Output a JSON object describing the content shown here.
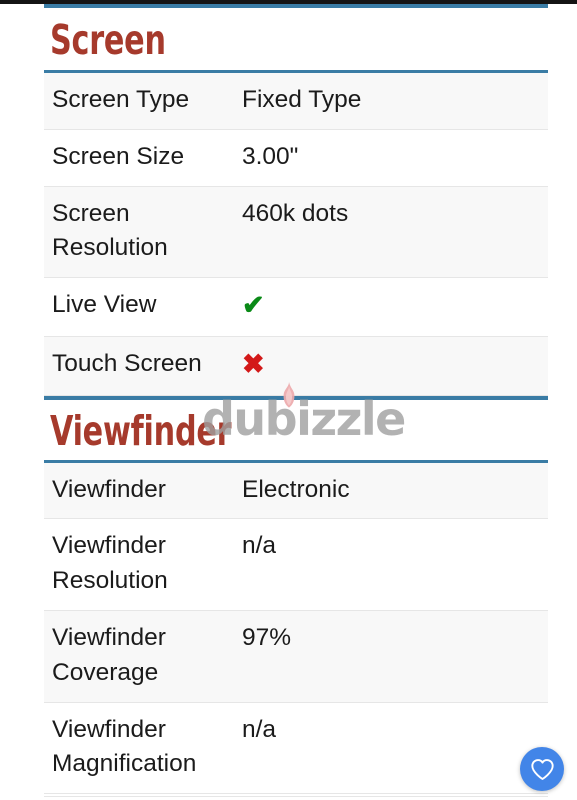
{
  "page": {
    "watermark": {
      "text": "dubizzle",
      "flame_icon": "flame-icon",
      "flame_color": "#e8a0a0",
      "text_color": "#a0a0a0"
    },
    "accent_rule_color": "#3a7ca5",
    "heading_color": "#a63a2c",
    "yes_color": "#0a8a17",
    "no_color": "#d31919"
  },
  "sections": [
    {
      "title": "Screen",
      "rows": [
        {
          "label": "Screen Type",
          "value": "Fixed Type",
          "kind": "text"
        },
        {
          "label": "Screen Size",
          "value": "3.00\"",
          "kind": "text"
        },
        {
          "label": "Screen Resolution",
          "value": "460k dots",
          "kind": "text"
        },
        {
          "label": "Live View",
          "value": "✔",
          "kind": "yes"
        },
        {
          "label": "Touch Screen",
          "value": "✖",
          "kind": "no"
        }
      ]
    },
    {
      "title": "Viewfinder",
      "rows": [
        {
          "label": "Viewfinder",
          "value": "Electronic",
          "kind": "text"
        },
        {
          "label": "Viewfinder Resolution",
          "value": "n/a",
          "kind": "text"
        },
        {
          "label": "Viewfinder Coverage",
          "value": "97%",
          "kind": "text"
        },
        {
          "label": "Viewfinder Magnification",
          "value": "n/a",
          "kind": "text"
        }
      ]
    }
  ],
  "fab": {
    "icon": "heart-icon",
    "label": "Add to favourites",
    "color": "#4285e8"
  }
}
